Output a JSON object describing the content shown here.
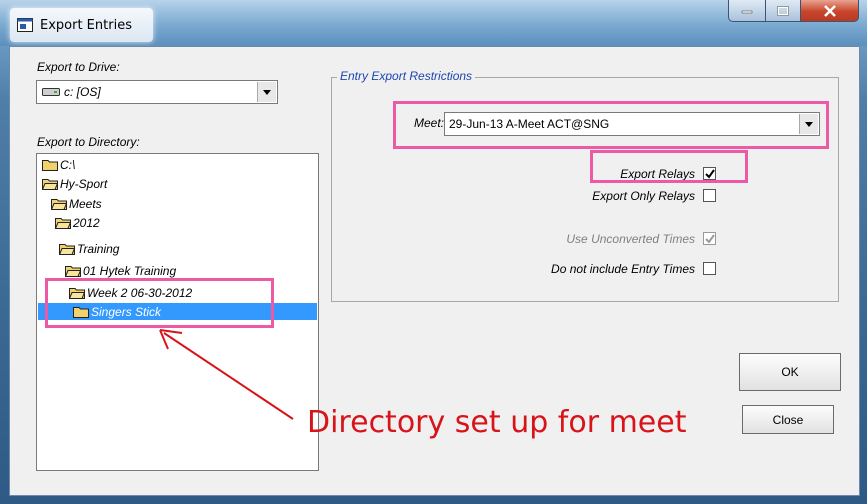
{
  "window": {
    "title": "Export Entries",
    "min_symbol": "–",
    "max_symbol": "□",
    "close_symbol": "X"
  },
  "left": {
    "drive_label": "Export to Drive:",
    "drive_value": "c: [OS]",
    "dir_label": "Export to Directory:",
    "tree": [
      {
        "label": "C:\\",
        "selected": false
      },
      {
        "label": "Hy-Sport",
        "selected": false
      },
      {
        "label": "Meets",
        "selected": false
      },
      {
        "label": "2012",
        "selected": false
      },
      {
        "label": "Training",
        "selected": false
      },
      {
        "label": "01 Hytek Training",
        "selected": false
      },
      {
        "label": "Week 2 06-30-2012",
        "selected": false
      },
      {
        "label": "Singers Stick",
        "selected": true
      }
    ]
  },
  "restrictions": {
    "group_title": "Entry Export Restrictions",
    "meet_label": "Meet:",
    "meet_value": "29-Jun-13 A-Meet ACT@SNG",
    "options": [
      {
        "label": "Export Relays",
        "checked": true,
        "disabled": false
      },
      {
        "label": "Export Only Relays",
        "checked": false,
        "disabled": false
      },
      {
        "label": "Use Unconverted Times",
        "checked": true,
        "disabled": true
      },
      {
        "label": "Do not include Entry Times",
        "checked": false,
        "disabled": false
      }
    ]
  },
  "buttons": {
    "ok": "OK",
    "close": "Close"
  },
  "annotation": {
    "text": "Directory set up for meet"
  },
  "colors": {
    "highlight": "#ec5aa6",
    "annotation": "#d8141b",
    "selection": "#3399ff"
  }
}
